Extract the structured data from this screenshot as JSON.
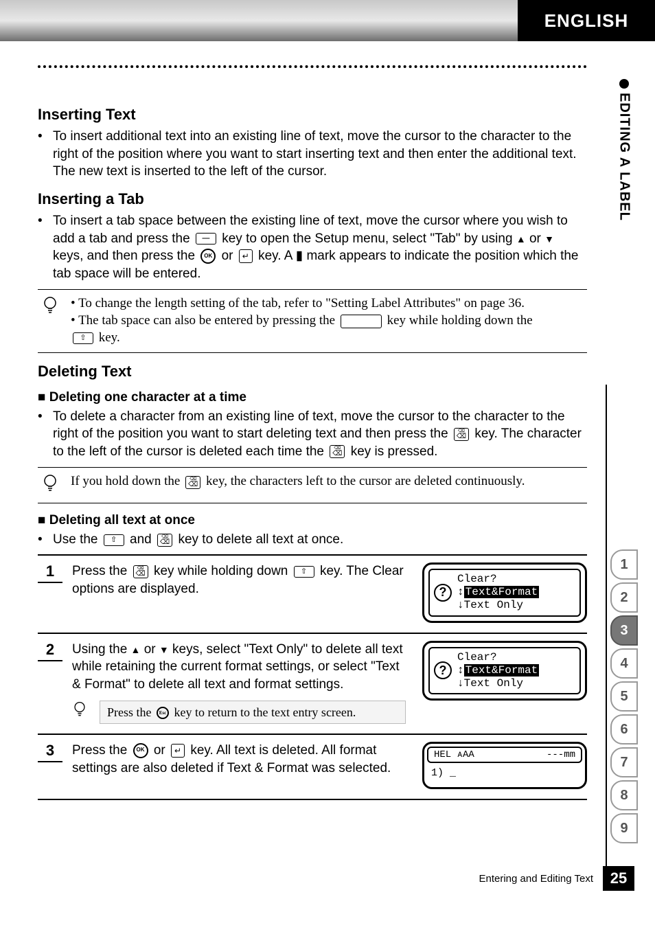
{
  "header": {
    "lang": "ENGLISH",
    "section_tab": "EDITING A LABEL"
  },
  "sections": {
    "inserting_text": {
      "title": "Inserting Text",
      "body": "To insert additional text into an existing line of text, move the cursor to the character to the right of the position where you want to start inserting text and then enter the additional text. The new text is inserted to the left of the cursor."
    },
    "inserting_tab": {
      "title": "Inserting a Tab",
      "body_pre": "To insert a tab space between the existing line of text, move the cursor where you wish to add a tab and press the ",
      "body_mid1": " key to open the Setup menu, select \"Tab\" by using ",
      "body_mid2": " keys, and then press the ",
      "body_mid3": " key. A ",
      "body_post": " mark appears to indicate the position which the tab space will be entered.",
      "tip1": "To change the length setting of the tab, refer to \"Setting Label Attributes\" on page 36.",
      "tip2_pre": "The tab space can also be entered by pressing the ",
      "tip2_mid": " key while holding down the ",
      "tip2_post": " key."
    },
    "deleting_text": {
      "title": "Deleting Text",
      "sub1": "Deleting one character at a time",
      "sub1_body_pre": "To delete a character from an existing line of text, move the cursor to the character to the right of the position you want to start deleting text and then press the ",
      "sub1_body_mid": " key. The character to the left of the cursor is deleted each time the ",
      "sub1_body_post": " key is pressed.",
      "sub1_tip_pre": "If you hold down the ",
      "sub1_tip_post": " key, the characters left to the cursor are deleted continuously.",
      "sub2": "Deleting all text at once",
      "sub2_body_pre": "Use the ",
      "sub2_body_mid": " and ",
      "sub2_body_post": " key to delete all text at once."
    }
  },
  "steps": [
    {
      "num": "1",
      "text_pre": "Press the ",
      "text_mid": " key while holding down ",
      "text_post": " key. The Clear options are displayed.",
      "screen": {
        "title": "Clear?",
        "opt_highlight": "Text&Format",
        "opt2": "Text Only"
      }
    },
    {
      "num": "2",
      "text_pre": "Using the ",
      "text_mid": " keys, select \"Text Only\" to delete all text while retaining the current format settings, or select \"Text & Format\" to delete all text and format settings.",
      "tip_pre": "Press the ",
      "tip_post": " key to return to the text entry screen.",
      "screen": {
        "title": "Clear?",
        "opt_highlight": "Text&Format",
        "opt2": "Text Only"
      }
    },
    {
      "num": "3",
      "text_pre": "Press the ",
      "text_mid": " or ",
      "text_post": " key. All text is deleted. All format settings are also deleted if Text & Format was selected.",
      "screen_editor": {
        "top_left": "HEL ᴀAA",
        "top_right": "---mm",
        "body": "1) _"
      }
    }
  ],
  "side_nav": [
    "1",
    "2",
    "3",
    "4",
    "5",
    "6",
    "7",
    "8",
    "9"
  ],
  "side_nav_active": "3",
  "footer": {
    "text": "Entering and Editing Text",
    "page": "25"
  },
  "icons": {
    "or": " or ",
    "arrow_up": "▲",
    "arrow_down": "▼",
    "ok": "OK",
    "enter": "↵",
    "tab_mark": "▮",
    "shift": "⇧",
    "esc": "Esc"
  }
}
